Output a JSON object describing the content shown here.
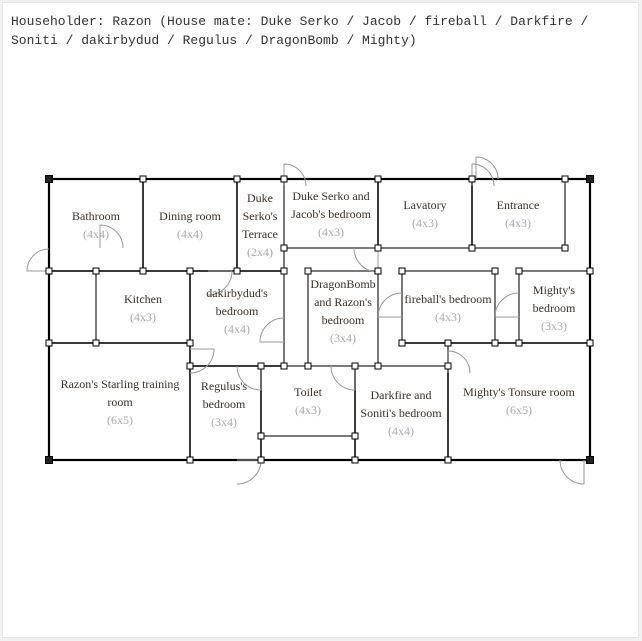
{
  "header": {
    "text": "Householder: Razon (House mate: Duke Serko / Jacob / fireball / Darkfire / Soniti / dakirbydud / Regulus / DragonBomb / Mighty)"
  },
  "colors": {
    "outer_wall": "#000000",
    "inner_wall": "#7a7a7a",
    "door": "#9a9a9a",
    "room_name": "#3b2f25",
    "room_dim": "#aaaaaa"
  },
  "rooms": [
    {
      "id": "bathroom",
      "name_lines": [
        "Bathroom"
      ],
      "size": "(4x4)"
    },
    {
      "id": "dining-room",
      "name_lines": [
        "Dining room"
      ],
      "size": "(4x4)"
    },
    {
      "id": "duke-serko-terrace",
      "name_lines": [
        "Duke",
        "Serko's",
        "Terrace"
      ],
      "size": "(2x4)"
    },
    {
      "id": "duke-serko-jacob-bedroom",
      "name_lines": [
        "Duke Serko and",
        "Jacob's bedroom"
      ],
      "size": "(4x3)"
    },
    {
      "id": "lavatory",
      "name_lines": [
        "Lavatory"
      ],
      "size": "(4x3)"
    },
    {
      "id": "entrance",
      "name_lines": [
        "Entrance"
      ],
      "size": "(4x3)"
    },
    {
      "id": "kitchen",
      "name_lines": [
        "Kitchen"
      ],
      "size": "(4x3)"
    },
    {
      "id": "dakirbydud-bedroom",
      "name_lines": [
        "dakirbydud's",
        "bedroom"
      ],
      "size": "(4x4)"
    },
    {
      "id": "dragonbomb-razon-bedroom",
      "name_lines": [
        "DragonBomb",
        "and Razon's",
        "bedroom"
      ],
      "size": "(3x4)"
    },
    {
      "id": "fireball-bedroom",
      "name_lines": [
        "fireball's bedroom"
      ],
      "size": "(4x3)"
    },
    {
      "id": "mighty-bedroom",
      "name_lines": [
        "Mighty's",
        "bedroom"
      ],
      "size": "(3x3)"
    },
    {
      "id": "razon-starling-training-room",
      "name_lines": [
        "Razon's Starling training",
        "room"
      ],
      "size": "(6x5)"
    },
    {
      "id": "regulus-bedroom",
      "name_lines": [
        "Regulus's",
        "bedroom"
      ],
      "size": "(3x4)"
    },
    {
      "id": "toilet",
      "name_lines": [
        "Toilet"
      ],
      "size": "(4x3)"
    },
    {
      "id": "darkfire-soniti-bedroom",
      "name_lines": [
        "Darkfire and",
        "Soniti's bedroom"
      ],
      "size": "(4x4)"
    },
    {
      "id": "mighty-tonsure-room",
      "name_lines": [
        "Mighty's Tonsure room"
      ],
      "size": "(6x5)"
    }
  ]
}
